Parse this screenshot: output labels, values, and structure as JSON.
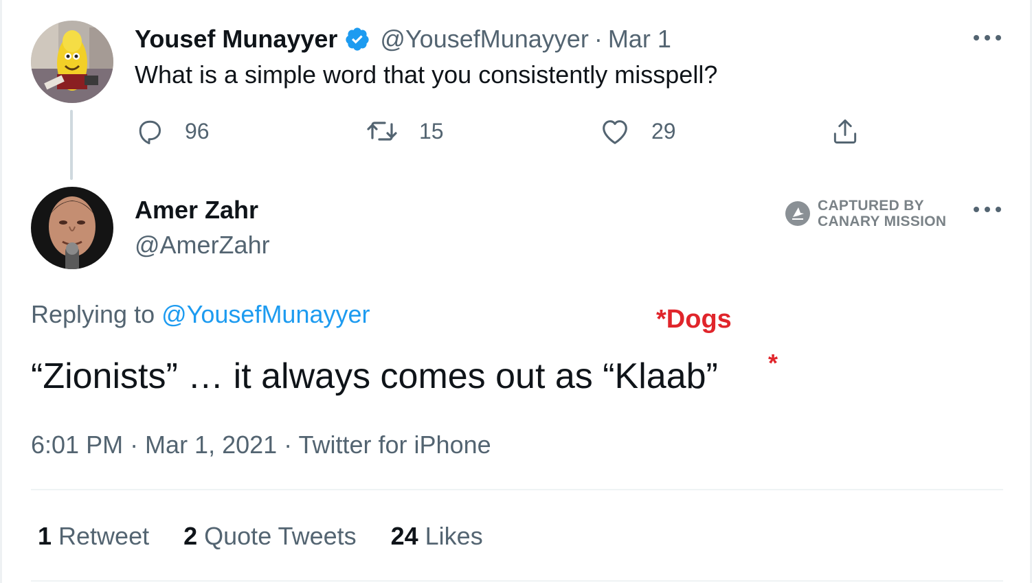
{
  "tweet1": {
    "author_name": "Yousef Munayyer",
    "handle": "@YousefMunayyer",
    "separator": "·",
    "date": "Mar 1",
    "verified": true,
    "text": "What is a simple word that you consistently misspell?",
    "actions": {
      "reply_count": "96",
      "retweet_count": "15",
      "like_count": "29"
    },
    "avatar_icon": "avatar-yousef-munayyer"
  },
  "tweet2": {
    "author_name": "Amer Zahr",
    "handle": "@AmerZahr",
    "avatar_icon": "avatar-amer-zahr",
    "replying_prefix": "Replying to",
    "replying_to": "@YousefMunayyer",
    "text": "“Zionists” … it always comes out as “Klaab”",
    "timestamp": "6:01 PM · Mar 1, 2021 · Twitter for iPhone",
    "stats": [
      {
        "count": "1",
        "label": "Retweet"
      },
      {
        "count": "2",
        "label": "Quote Tweets"
      },
      {
        "count": "24",
        "label": "Likes"
      }
    ]
  },
  "watermark": {
    "line1": "CAPTURED BY",
    "line2": "CANARY MISSION",
    "icon": "canary-mission-logo"
  },
  "annotation": {
    "note": "*Dogs",
    "marker": "*"
  },
  "colors": {
    "text_primary": "#0f1419",
    "text_secondary": "#536471",
    "link": "#1d9bf0",
    "verified": "#1d9bf0",
    "annotation": "#e0252b"
  }
}
